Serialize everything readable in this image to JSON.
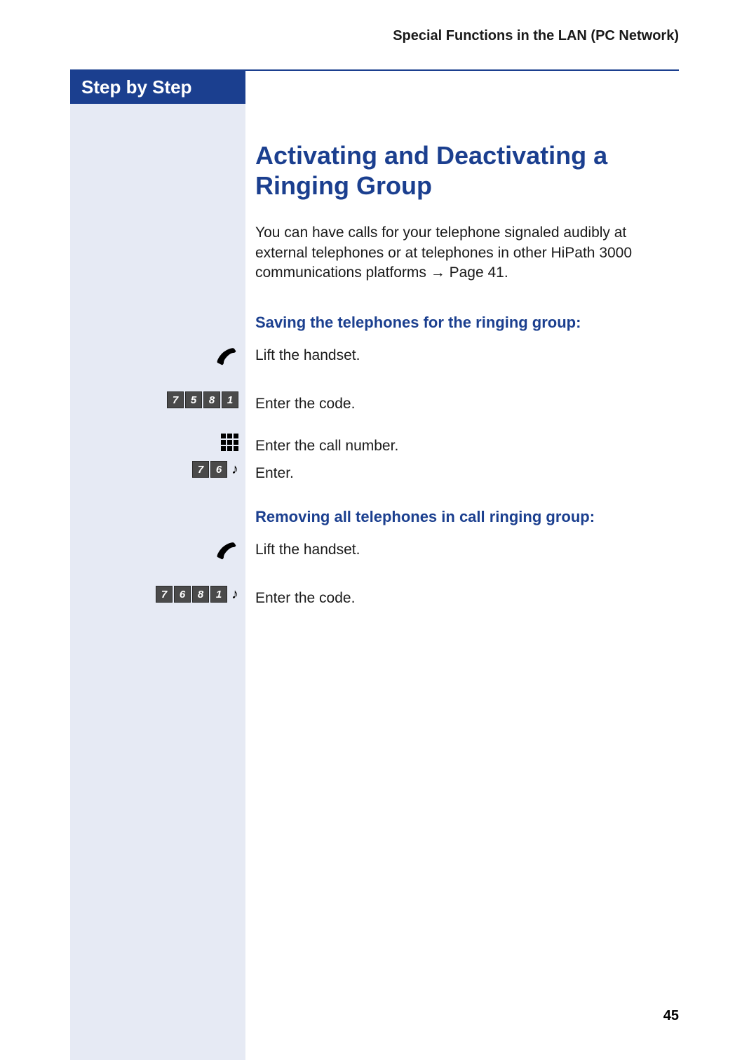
{
  "header": {
    "section_title": "Special Functions in the LAN (PC Network)"
  },
  "sidebar": {
    "label": "Step by Step"
  },
  "main": {
    "title": "Activating and Deactivating a Ringing Group",
    "intro_pre": "You can have calls for your telephone signaled audibly at external telephones or at telephones in other HiPath 3000 communications platforms ",
    "intro_arrow": "→",
    "intro_post": " Page 41."
  },
  "section1": {
    "heading": "Saving the telephones for the ringing group:",
    "steps": {
      "lift": "Lift the handset.",
      "enter_code": "Enter the code.",
      "enter_call_number": "Enter the call number.",
      "enter": "Enter."
    },
    "code1": [
      "7",
      "5",
      "8",
      "1"
    ],
    "code2": [
      "7",
      "6"
    ]
  },
  "section2": {
    "heading": "Removing all telephones in call ringing group:",
    "steps": {
      "lift": "Lift the handset.",
      "enter_code": "Enter the code."
    },
    "code": [
      "7",
      "6",
      "8",
      "1"
    ]
  },
  "page_number": "45"
}
